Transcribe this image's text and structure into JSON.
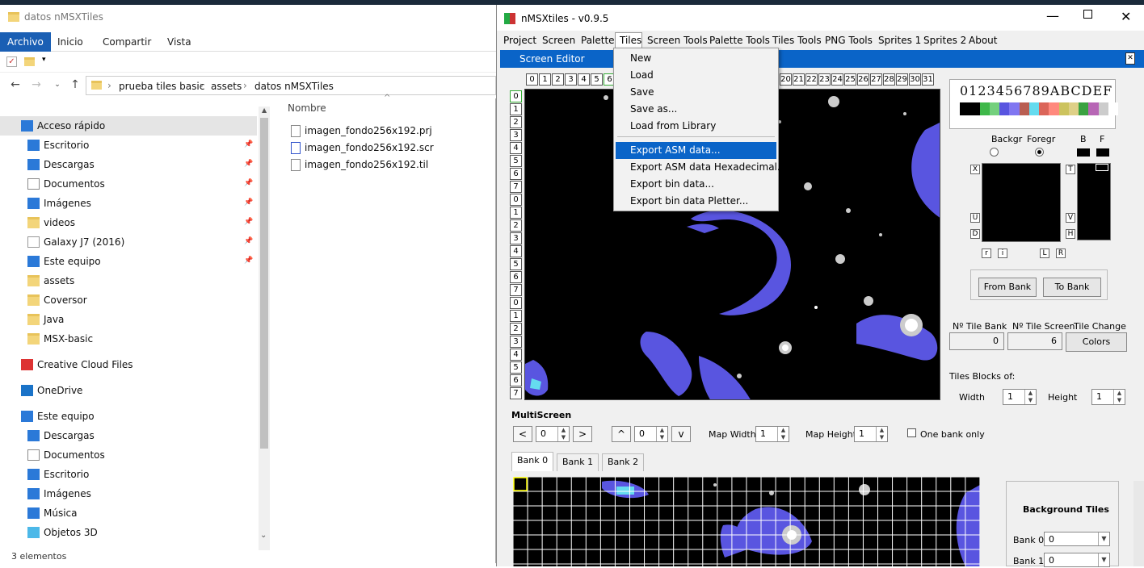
{
  "explorer": {
    "window_title": "datos nMSXTiles",
    "ribbon_tabs": [
      "Archivo",
      "Inicio",
      "Compartir",
      "Vista"
    ],
    "breadcrumb": [
      "prueba tiles basic",
      "assets",
      "datos nMSXTiles"
    ],
    "column_header": "Nombre",
    "nav_items": [
      {
        "label": "Acceso rápido",
        "icon": "star-icon",
        "pinned": false
      },
      {
        "label": "Escritorio",
        "icon": "desktop-icon",
        "pinned": true
      },
      {
        "label": "Descargas",
        "icon": "download-icon",
        "pinned": true
      },
      {
        "label": "Documentos",
        "icon": "document-icon",
        "pinned": true
      },
      {
        "label": "Imágenes",
        "icon": "image-icon",
        "pinned": true
      },
      {
        "label": "videos",
        "icon": "folder-icon",
        "pinned": true
      },
      {
        "label": "Galaxy J7 (2016)",
        "icon": "phone-icon",
        "pinned": true
      },
      {
        "label": "Este equipo",
        "icon": "computer-icon",
        "pinned": true
      },
      {
        "label": "assets",
        "icon": "folder-icon",
        "pinned": false
      },
      {
        "label": "Coversor",
        "icon": "folder-icon",
        "pinned": false
      },
      {
        "label": "Java",
        "icon": "folder-icon",
        "pinned": false
      },
      {
        "label": "MSX-basic",
        "icon": "folder-icon",
        "pinned": false
      },
      {
        "label": "Creative Cloud Files",
        "icon": "creative-cloud-icon",
        "pinned": false
      },
      {
        "label": "OneDrive",
        "icon": "cloud-icon",
        "pinned": false
      },
      {
        "label": "Este equipo",
        "icon": "computer-icon",
        "pinned": false
      },
      {
        "label": "Descargas",
        "icon": "download-icon",
        "pinned": false
      },
      {
        "label": "Documentos",
        "icon": "document-icon",
        "pinned": false
      },
      {
        "label": "Escritorio",
        "icon": "desktop-icon",
        "pinned": false
      },
      {
        "label": "Imágenes",
        "icon": "image-icon",
        "pinned": false
      },
      {
        "label": "Música",
        "icon": "music-icon",
        "pinned": false
      },
      {
        "label": "Objetos 3D",
        "icon": "cube-icon",
        "pinned": false
      }
    ],
    "files": [
      "imagen_fondo256x192.prj",
      "imagen_fondo256x192.scr",
      "imagen_fondo256x192.til"
    ],
    "status": "3 elementos"
  },
  "nmsx": {
    "window_title": "nMSXtiles - v0.9.5",
    "menu": [
      "Project",
      "Screen",
      "Palette",
      "Tiles",
      "Screen Tools",
      "Palette Tools",
      "Tiles Tools",
      "PNG Tools",
      "Sprites 1",
      "Sprites 2",
      "About"
    ],
    "active_tab": "Screen Editor",
    "col_headers": [
      "0",
      "1",
      "2",
      "3",
      "4",
      "5",
      "6",
      "20",
      "21",
      "22",
      "23",
      "24",
      "25",
      "26",
      "27",
      "28",
      "29",
      "30",
      "31"
    ],
    "row_headers": [
      "0",
      "1",
      "2",
      "3",
      "4",
      "5",
      "6",
      "7",
      "0",
      "1",
      "2",
      "3",
      "4",
      "5",
      "6",
      "7",
      "0",
      "1",
      "2",
      "3",
      "4",
      "5",
      "6",
      "7"
    ],
    "hex_digits": "0123456789ABCDEF",
    "palette": [
      "#000000",
      "#000000",
      "#3eb849",
      "#74d07d",
      "#5955e0",
      "#8076f1",
      "#b95e51",
      "#65dbef",
      "#db6559",
      "#ff897d",
      "#ccc35e",
      "#ded087",
      "#3aa241",
      "#b766b5",
      "#cccccc",
      "#ffffff"
    ],
    "labels": {
      "backgr": "Backgr",
      "foregr": "Foregr",
      "b": "B",
      "f": "F",
      "x": "X",
      "t": "T",
      "u": "U",
      "d": "D",
      "v": "V",
      "h": "H",
      "r1": "r",
      "i": "i",
      "l": "L",
      "r2": "R",
      "from_bank": "From Bank",
      "to_bank": "To Bank",
      "tile_bank": "Nº Tile Bank",
      "tile_screen": "Nº Tile Screen",
      "tile_change": "Tile Change",
      "tile_bank_val": "0",
      "tile_screen_val": "6",
      "colors": "Colors",
      "tiles_blocks": "Tiles Blocks of:",
      "width": "Width",
      "width_val": "1",
      "height": "Height",
      "height_val": "1"
    },
    "multiscreen": {
      "title": "MultiScreen",
      "prev": "<",
      "next": ">",
      "up": "^",
      "down": "v",
      "x_val": "0",
      "y_val": "0",
      "map_width": "Map Width",
      "map_width_val": "1",
      "map_height": "Map Height",
      "map_height_val": "1",
      "one_bank": "One bank only"
    },
    "bank_tabs": [
      "Bank 0",
      "Bank 1",
      "Bank 2"
    ],
    "background_tiles": {
      "title": "Background Tiles",
      "bank0": "Bank 0",
      "bank0_val": "0",
      "bank1": "Bank 1",
      "bank1_val": "0"
    },
    "tiles_menu": {
      "items": [
        "New",
        "Load",
        "Save",
        "Save as...",
        "Load from Library",
        "Export ASM data...",
        "Export ASM data Hexadecimal...",
        "Export bin data...",
        "Export bin data Pletter..."
      ],
      "selected": "Export ASM data..."
    }
  }
}
